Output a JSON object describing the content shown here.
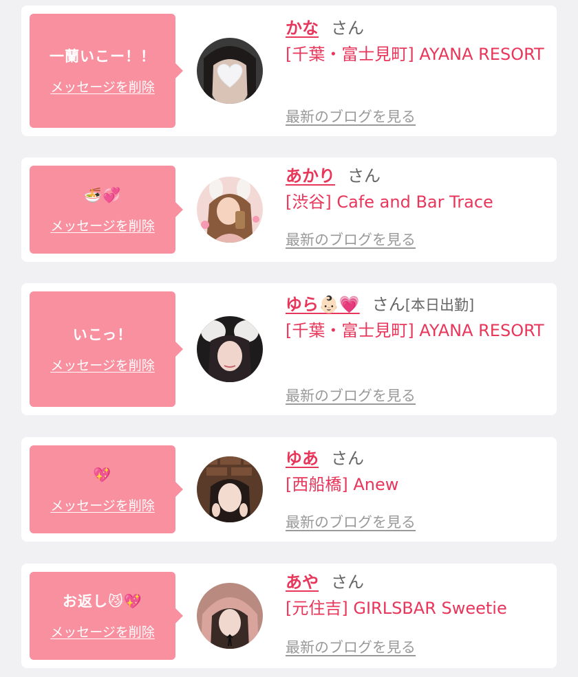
{
  "common": {
    "delete_label": "メッセージを削除",
    "blog_label": "最新のブログを見る",
    "honorific": "さん"
  },
  "cards": [
    {
      "message": "一蘭いこー！！",
      "name": "かな",
      "status": "",
      "shop": "[千葉・富士見町] AYANA RESORT",
      "avatar": "heart-masked portrait, dark hair"
    },
    {
      "message": "🍜💞",
      "name": "あかり",
      "status": "",
      "shop": "[渋谷] Cafe and Bar Trace",
      "avatar": "illustrated girl with bunny ears taking a selfie"
    },
    {
      "message": "いこっ！",
      "name": "ゆら👶🏻💗",
      "status": "[本日出勤]",
      "shop": "[千葉・富士見町] AYANA RESORT",
      "avatar": "girl with fluffy white ears"
    },
    {
      "message": "💖",
      "name": "ゆあ",
      "status": "",
      "shop": "[西船橋] Anew",
      "avatar": "girl with peace sign, brick wall"
    },
    {
      "message": "お返し😼💖",
      "name": "あや",
      "status": "",
      "shop": "[元住吉] GIRLSBAR Sweetie",
      "avatar": "girl in pink hood with black ribbon"
    }
  ]
}
